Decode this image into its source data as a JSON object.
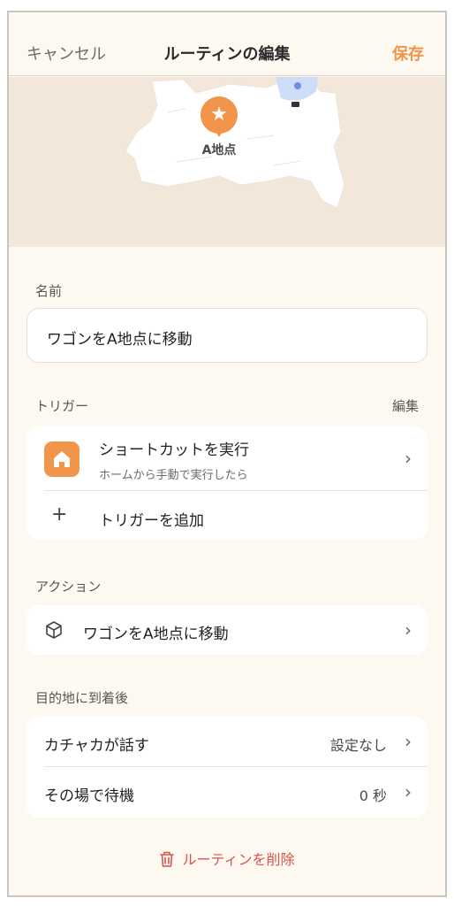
{
  "nav": {
    "cancel_label": "キャンセル",
    "title": "ルーティンの編集",
    "save_label": "保存"
  },
  "map": {
    "pin_label": "A地点",
    "pin_icon": "star-icon",
    "pin_color": "#f0954a"
  },
  "name_section": {
    "label": "名前",
    "value": "ワゴンをA地点に移動"
  },
  "trigger_section": {
    "label": "トリガー",
    "edit_label": "編集",
    "items": [
      {
        "title": "ショートカットを実行",
        "subtitle": "ホームから手動で実行したら",
        "icon": "home-icon"
      }
    ],
    "add_label": "トリガーを追加"
  },
  "action_section": {
    "label": "アクション",
    "items": [
      {
        "title": "ワゴンをA地点に移動",
        "icon": "cube-icon"
      }
    ]
  },
  "arrival_section": {
    "label": "目的地に到着後",
    "items": [
      {
        "title": "カチャカが話す",
        "value": "設定なし"
      },
      {
        "title": "その場で待機",
        "value": "0 秒"
      }
    ]
  },
  "delete_label": "ルーティンを削除",
  "colors": {
    "accent": "#f0954a",
    "danger": "#d9534f",
    "background": "#fdf9f1"
  }
}
